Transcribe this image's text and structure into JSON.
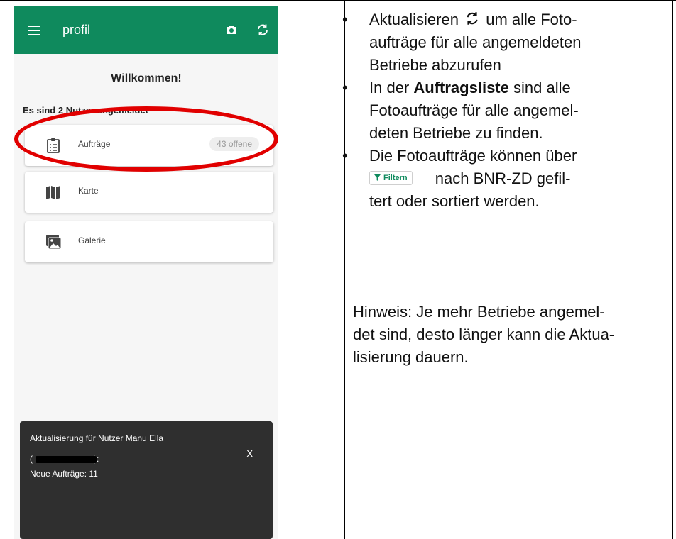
{
  "app": {
    "title": "profil",
    "welcome": "Willkommen!",
    "users_text": "Es sind 2 Nutzer angemeldet",
    "menu": [
      {
        "label": "Aufträge",
        "badge": "43 offene",
        "icon": "clipboard-list-icon"
      },
      {
        "label": "Karte",
        "icon": "map-icon"
      },
      {
        "label": "Galerie",
        "icon": "gallery-icon"
      }
    ],
    "snackbar": {
      "line1": "Aktualisierung für Nutzer Manu Ella",
      "line2_open": "(",
      "line2_close": "):",
      "line3": "Neue Aufträge: 11",
      "close": "X"
    }
  },
  "doc": {
    "bullet_dot": "•",
    "b1_part1": "Aktualisieren",
    "b1_part2": "um alle Foto-",
    "b1_line2": "aufträge für alle angemeldeten",
    "b1_line3": "Betriebe abzurufen",
    "b2_part1": "In der",
    "b2_bold": "Auftragsliste",
    "b2_part2": "sind alle",
    "b2_line2": "Fotoaufträge für alle angemel-",
    "b2_line3": "deten Betriebe zu finden.",
    "b3_line1": "Die Fotoaufträge können über",
    "filter_label": "Filtern",
    "b3_line2_rest": "nach BNR-ZD gefil-",
    "b3_line3": "tert oder sortiert werden.",
    "hint_line1": "Hinweis: Je mehr Betriebe angemel-",
    "hint_line2": "det sind, desto länger kann die Aktua-",
    "hint_line3": "lisierung dauern."
  },
  "colors": {
    "appbar": "#0f8a5d",
    "highlight": "#e10000",
    "snackbar": "#2f2f2f"
  }
}
